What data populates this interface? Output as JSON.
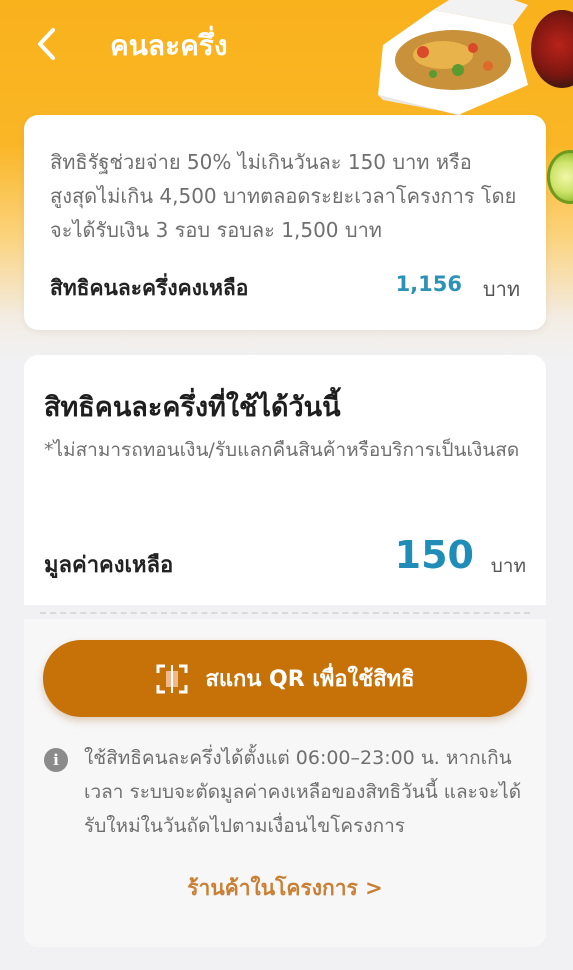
{
  "header": {
    "title": "คนละครึ่ง"
  },
  "summary": {
    "description": "สิทธิรัฐช่วยจ่าย 50% ไม่เกินวันละ 150 บาท หรือ สูงสุดไม่เกิน 4,500 บาทตลอดระยะเวลาโครงการ โดยจะได้รับเงิน 3 รอบ รอบละ 1,500 บาท",
    "remaining_label": "สิทธิคนละครึ่งคงเหลือ",
    "remaining_value": "1,156",
    "remaining_unit": "บาท"
  },
  "today": {
    "heading": "สิทธิคนละครึ่งที่ใช้ได้วันนี้",
    "note": "*ไม่สามารถทอนเงิน/รับแลกคืนสินค้าหรือบริการเป็นเงินสด",
    "balance_label": "มูลค่าคงเหลือ",
    "balance_value": "150",
    "balance_unit": "บาท"
  },
  "actions": {
    "scan_label": "สแกน QR เพื่อใช้สิทธิ",
    "info_text": "ใช้สิทธิคนละครึ่งได้ตั้งแต่ 06:00–23:00 น. หากเกินเวลา ระบบจะตัดมูลค่าคงเหลือของสิทธิวันนี้ และจะได้รับใหม่ในวันถัดไปตามเงื่อนไขโครงการ",
    "shops_link": "ร้านค้าในโครงการ >"
  },
  "colors": {
    "header_yellow": "#f9b21c",
    "scan_button": "#c77208",
    "value_blue": "#1f8db8",
    "link_orange": "#c98034"
  },
  "icons": {
    "back": "chevron-left-icon",
    "scan": "qr-scan-icon",
    "info": "info-icon"
  }
}
